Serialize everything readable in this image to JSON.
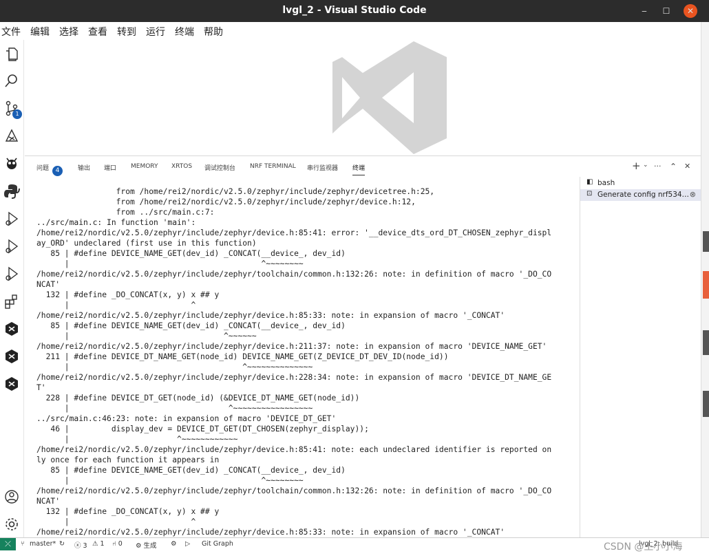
{
  "window": {
    "title": "lvgl_2 - Visual Studio Code",
    "minimize": "‒",
    "maximize": "☐",
    "close": "✕"
  },
  "menu": [
    "文件",
    "编辑",
    "选择",
    "查看",
    "转到",
    "运行",
    "终端",
    "帮助"
  ],
  "activity_bar": {
    "items": [
      "explorer-icon",
      "search-icon",
      "source-control-icon",
      "extension-icon",
      "bug-icon",
      "python-icon",
      "debug-icon",
      "debug-icon",
      "debug-icon",
      "extensions-icon",
      "nordic-icon",
      "nordic-icon",
      "nordic-icon"
    ],
    "scm_badge": "1",
    "bottom": [
      "account-icon",
      "gear-icon"
    ]
  },
  "panel": {
    "tabs": [
      {
        "label": "问题",
        "count": "4"
      },
      {
        "label": "输出"
      },
      {
        "label": "端口"
      },
      {
        "label": "MEMORY"
      },
      {
        "label": "XRTOS"
      },
      {
        "label": "调试控制台"
      },
      {
        "label": "NRF TERMINAL"
      },
      {
        "label": "串行监视器"
      },
      {
        "label": "终端"
      }
    ],
    "actions": {
      "add": "+",
      "chevron": "⌄",
      "more": "···",
      "maximize": "⌃",
      "close": "✕"
    }
  },
  "terminal": {
    "lines": [
      "                 from /home/rei2/nordic/v2.5.0/zephyr/include/zephyr/devicetree.h:25,",
      "                 from /home/rei2/nordic/v2.5.0/zephyr/include/zephyr/device.h:12,",
      "                 from ../src/main.c:7:",
      "../src/main.c: In function 'main':",
      "/home/rei2/nordic/v2.5.0/zephyr/include/zephyr/device.h:85:41: error: '__device_dts_ord_DT_CHOSEN_zephyr_displ",
      "ay_ORD' undeclared (first use in this function)",
      "   85 | #define DEVICE_NAME_GET(dev_id) _CONCAT(__device_, dev_id)",
      "      |                                         ^~~~~~~~~",
      "/home/rei2/nordic/v2.5.0/zephyr/include/zephyr/toolchain/common.h:132:26: note: in definition of macro '_DO_CO",
      "NCAT'",
      "  132 | #define _DO_CONCAT(x, y) x ## y",
      "      |                          ^",
      "/home/rei2/nordic/v2.5.0/zephyr/include/zephyr/device.h:85:33: note: in expansion of macro '_CONCAT'",
      "   85 | #define DEVICE_NAME_GET(dev_id) _CONCAT(__device_, dev_id)",
      "      |                                 ^~~~~~~",
      "/home/rei2/nordic/v2.5.0/zephyr/include/zephyr/device.h:211:37: note: in expansion of macro 'DEVICE_NAME_GET'",
      "  211 | #define DEVICE_DT_NAME_GET(node_id) DEVICE_NAME_GET(Z_DEVICE_DT_DEV_ID(node_id))",
      "      |                                     ^~~~~~~~~~~~~~~",
      "/home/rei2/nordic/v2.5.0/zephyr/include/zephyr/device.h:228:34: note: in expansion of macro 'DEVICE_DT_NAME_GE",
      "T'",
      "  228 | #define DEVICE_DT_GET(node_id) (&DEVICE_DT_NAME_GET(node_id))",
      "      |                                  ^~~~~~~~~~~~~~~~~~",
      "../src/main.c:46:23: note: in expansion of macro 'DEVICE_DT_GET'",
      "   46 |         display_dev = DEVICE_DT_GET(DT_CHOSEN(zephyr_display));",
      "      |                       ^~~~~~~~~~~~~",
      "/home/rei2/nordic/v2.5.0/zephyr/include/zephyr/device.h:85:41: note: each undeclared identifier is reported on",
      "ly once for each function it appears in",
      "   85 | #define DEVICE_NAME_GET(dev_id) _CONCAT(__device_, dev_id)",
      "      |                                         ^~~~~~~~~",
      "/home/rei2/nordic/v2.5.0/zephyr/include/zephyr/toolchain/common.h:132:26: note: in definition of macro '_DO_CO",
      "NCAT'",
      "  132 | #define _DO_CONCAT(x, y) x ## y",
      "      |                          ^",
      "/home/rei2/nordic/v2.5.0/zephyr/include/zephyr/device.h:85:33: note: in expansion of macro '_CONCAT'"
    ]
  },
  "terminal_list": [
    {
      "label": "bash",
      "icon": "terminal-icon"
    },
    {
      "label": "Generate config nrf534…",
      "icon": "terminal-icon",
      "close": "⊗"
    }
  ],
  "statusbar": {
    "remote": "⤫",
    "branch": "master*",
    "sync": "↻",
    "errors": "ⓧ 3",
    "warnings": "⚠ 1",
    "ports": "⑁ 0",
    "build": "⚙ 生成",
    "bug": "⚙",
    "run": "▷",
    "git_graph": "Git Graph",
    "right_build": "lvgl_2: build"
  },
  "watermark": "CSDN @王小小海"
}
